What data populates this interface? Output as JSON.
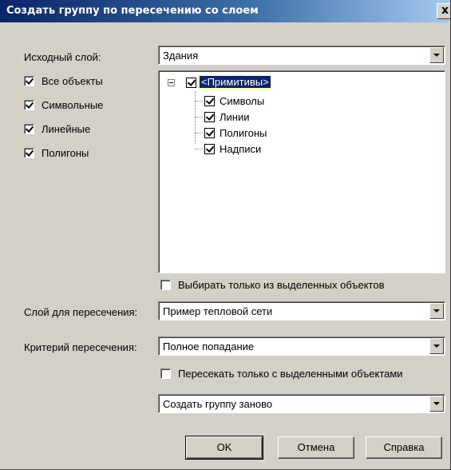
{
  "window": {
    "title": "Создать группу по пересечению со слоем",
    "close_glyph": "x"
  },
  "source_layer": {
    "label": "Исходный слой:",
    "value": "Здания"
  },
  "object_types": [
    {
      "label": "Все объекты",
      "checked": true
    },
    {
      "label": "Символьные",
      "checked": true
    },
    {
      "label": "Линейные",
      "checked": true
    },
    {
      "label": "Полигоны",
      "checked": true
    }
  ],
  "tree": {
    "root": {
      "label": "<Примитивы>",
      "checked": true,
      "expanded": true
    },
    "children": [
      {
        "label": "Символы",
        "checked": true
      },
      {
        "label": "Линии",
        "checked": true
      },
      {
        "label": "Полигоны",
        "checked": true
      },
      {
        "label": "Надписи",
        "checked": true
      }
    ]
  },
  "select_only_selected": {
    "label": "Выбирать только из выделенных объектов",
    "checked": false
  },
  "intersect_layer": {
    "label": "Слой для пересечения:",
    "value": "Пример тепловой сети"
  },
  "intersect_criteria": {
    "label": "Критерий пересечения:",
    "value": "Полное попадание"
  },
  "intersect_only_selected": {
    "label": "Пересекать только с выделенными объектами",
    "checked": false
  },
  "group_mode": {
    "value": "Создать группу заново"
  },
  "buttons": {
    "ok": "OK",
    "cancel": "Отмена",
    "help": "Справка"
  },
  "colors": {
    "dialog_bg": "#d4d0c8",
    "title_start": "#0a246a",
    "title_end": "#a6caf0",
    "selection": "#0a246a"
  }
}
